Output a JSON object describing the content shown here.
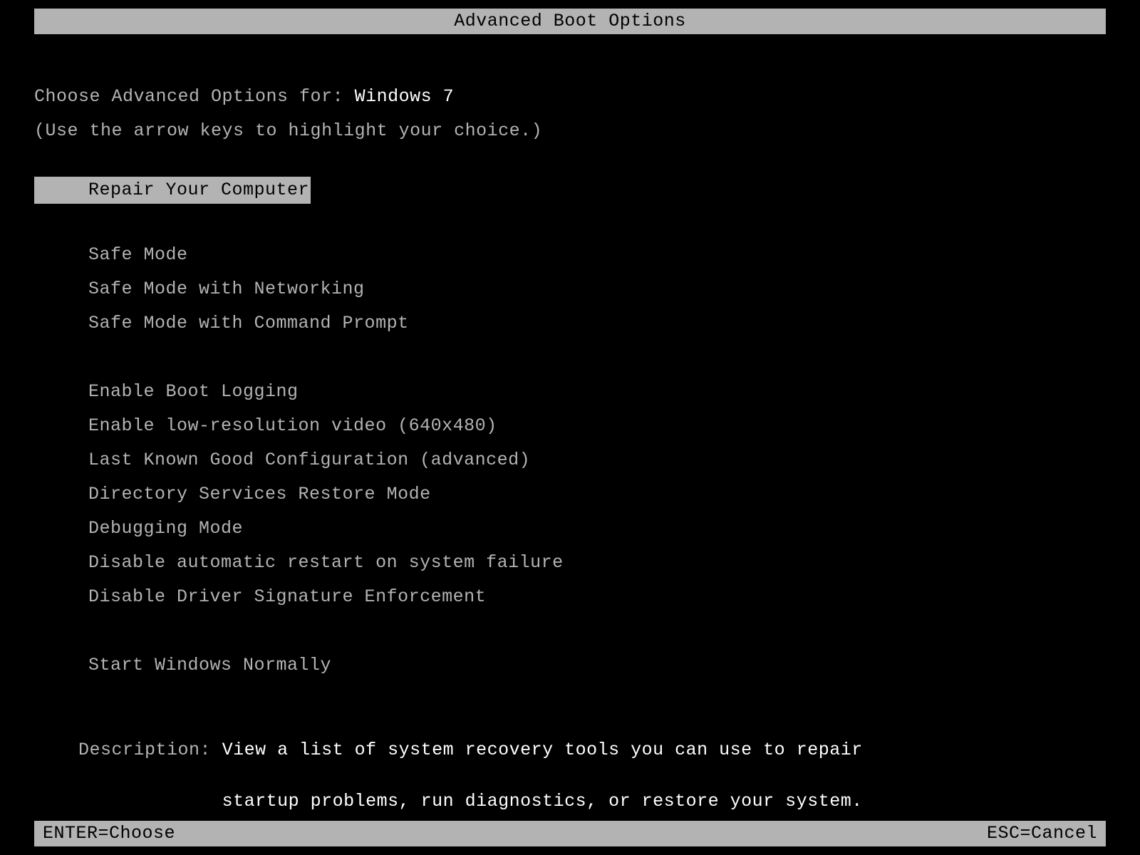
{
  "title": "Advanced Boot Options",
  "prompt_label": "Choose Advanced Options for: ",
  "os_name": "Windows 7",
  "hint": "(Use the arrow keys to highlight your choice.)",
  "menu": {
    "groups": [
      [
        "Repair Your Computer"
      ],
      [
        "Safe Mode",
        "Safe Mode with Networking",
        "Safe Mode with Command Prompt"
      ],
      [
        "Enable Boot Logging",
        "Enable low-resolution video (640x480)",
        "Last Known Good Configuration (advanced)",
        "Directory Services Restore Mode",
        "Debugging Mode",
        "Disable automatic restart on system failure",
        "Disable Driver Signature Enforcement"
      ],
      [
        "Start Windows Normally"
      ]
    ],
    "selected": "Repair Your Computer"
  },
  "description_label": "Description: ",
  "description_line1": "View a list of system recovery tools you can use to repair",
  "description_pad": "             ",
  "description_line2": "startup problems, run diagnostics, or restore your system.",
  "footer": {
    "enter": "ENTER=Choose",
    "esc": "ESC=Cancel"
  }
}
